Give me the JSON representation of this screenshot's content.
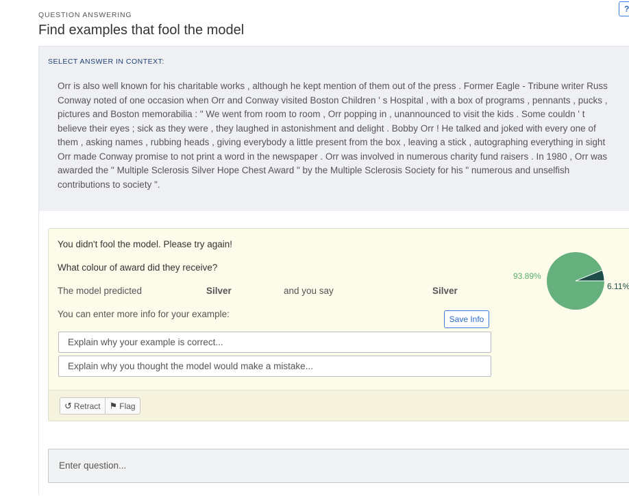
{
  "header": {
    "help_label": "?",
    "eyebrow": "QUESTION ANSWERING",
    "title": "Find examples that fool the model"
  },
  "context": {
    "label": "SELECT ANSWER IN CONTEXT:",
    "lines": [
      "Orr is also well known for his charitable works , although he kept mention of them out of the press . Former Eagle - Tribune writer Russ",
      "Conway noted of one occasion when Orr and Conway visited Boston Children ' s Hospital , with a box of programs , pennants , pucks ,",
      "pictures and Boston memorabilia : \" We went from room to room , Orr popping in , unannounced to visit the kids . Some couldn ' t",
      "believe their eyes ; sick as they were , they laughed in astonishment and delight . Bobby Orr ! He talked and joked with every one of",
      "them , asking names , rubbing heads , giving everybody a little present from the box , leaving a stick , autographing everything in sight",
      "Orr made Conway promise to not print a word in the newspaper . Orr was involved in numerous charity fund raisers . In 1980 , Orr was",
      "awarded the \" Multiple Sclerosis Silver Hope Chest Award \" by the Multiple Sclerosis Society for his \" numerous and unselfish",
      "contributions to society \"."
    ]
  },
  "result": {
    "message": "You didn't fool the model. Please try again!",
    "question": "What colour of award did they receive?",
    "prediction_label": "The model predicted",
    "prediction_value": "Silver",
    "user_label": "and you say",
    "user_value": "Silver",
    "more_info_label": "You can enter more info for your example:",
    "save_button": "Save Info",
    "explain_correct_placeholder": "Explain why your example is correct...",
    "explain_mistake_placeholder": "Explain why you thought the model would make a mistake...",
    "retract_button": "Retract",
    "flag_button": "Flag",
    "confidence": {
      "major_label": "93.89%",
      "minor_label": "6.11%",
      "major_value": 93.89,
      "minor_value": 6.11,
      "major_color": "#66b07e",
      "minor_color": "#1e4d4a"
    }
  },
  "question_input": {
    "placeholder": "Enter question..."
  },
  "icons": {
    "retract": "undo-icon",
    "flag": "flag-icon"
  }
}
